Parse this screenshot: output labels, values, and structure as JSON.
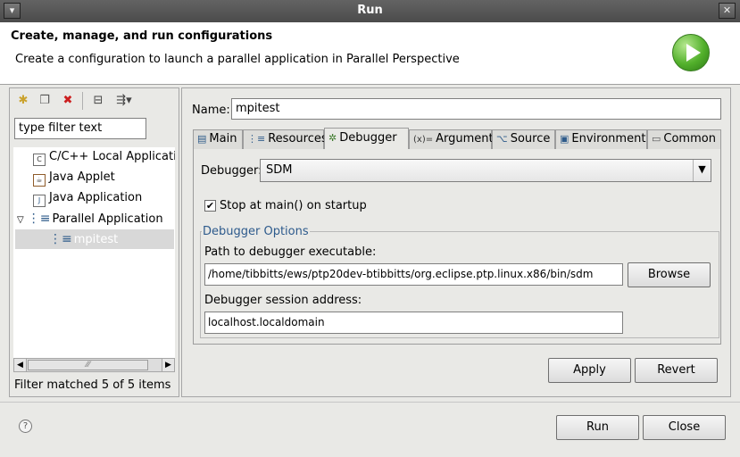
{
  "window": {
    "title": "Run"
  },
  "header": {
    "title": "Create, manage, and run configurations",
    "message": "Create a configuration to launch a parallel application in Parallel Perspective"
  },
  "left": {
    "filter_placeholder": "type filter text",
    "tree": [
      {
        "label": "C/C++ Local Application",
        "icon": "c-app-icon",
        "indent": 1
      },
      {
        "label": "Java Applet",
        "icon": "java-applet-icon",
        "indent": 1
      },
      {
        "label": "Java Application",
        "icon": "java-app-icon",
        "indent": 1
      },
      {
        "label": "Parallel Application",
        "icon": "parallel-app-icon",
        "indent": 0,
        "expanded": true
      },
      {
        "label": "mpitest",
        "icon": "parallel-config-icon",
        "indent": 2,
        "selected": true
      }
    ],
    "status": "Filter matched 5 of 5 items"
  },
  "right": {
    "name_label": "Name:",
    "name_value": "mpitest",
    "tabs": [
      {
        "label": "Main",
        "icon": "main-tab-icon"
      },
      {
        "label": "Resources",
        "icon": "resources-tab-icon"
      },
      {
        "label": "Debugger",
        "icon": "debugger-tab-icon",
        "active": true
      },
      {
        "label": "Arguments",
        "icon": "arguments-tab-icon",
        "icon_text": "(x)="
      },
      {
        "label": "Source",
        "icon": "source-tab-icon"
      },
      {
        "label": "Environment",
        "icon": "environment-tab-icon"
      },
      {
        "label": "Common",
        "icon": "common-tab-icon"
      }
    ],
    "debugger_label": "Debugger:",
    "debugger_value": "SDM",
    "stop_at_main_label": "Stop at main() on startup",
    "stop_at_main_checked": true,
    "options_group_label": "Debugger Options",
    "path_label": "Path to debugger executable:",
    "path_value": "/home/tibbitts/ews/ptp20dev-btibbitts/org.eclipse.ptp.linux.x86/bin/sdm",
    "browse_label": "Browse",
    "session_label": "Debugger session address:",
    "session_value": "localhost.localdomain",
    "apply_label": "Apply",
    "revert_label": "Revert"
  },
  "footer": {
    "help_icon": "?",
    "run_label": "Run",
    "close_label": "Close"
  }
}
